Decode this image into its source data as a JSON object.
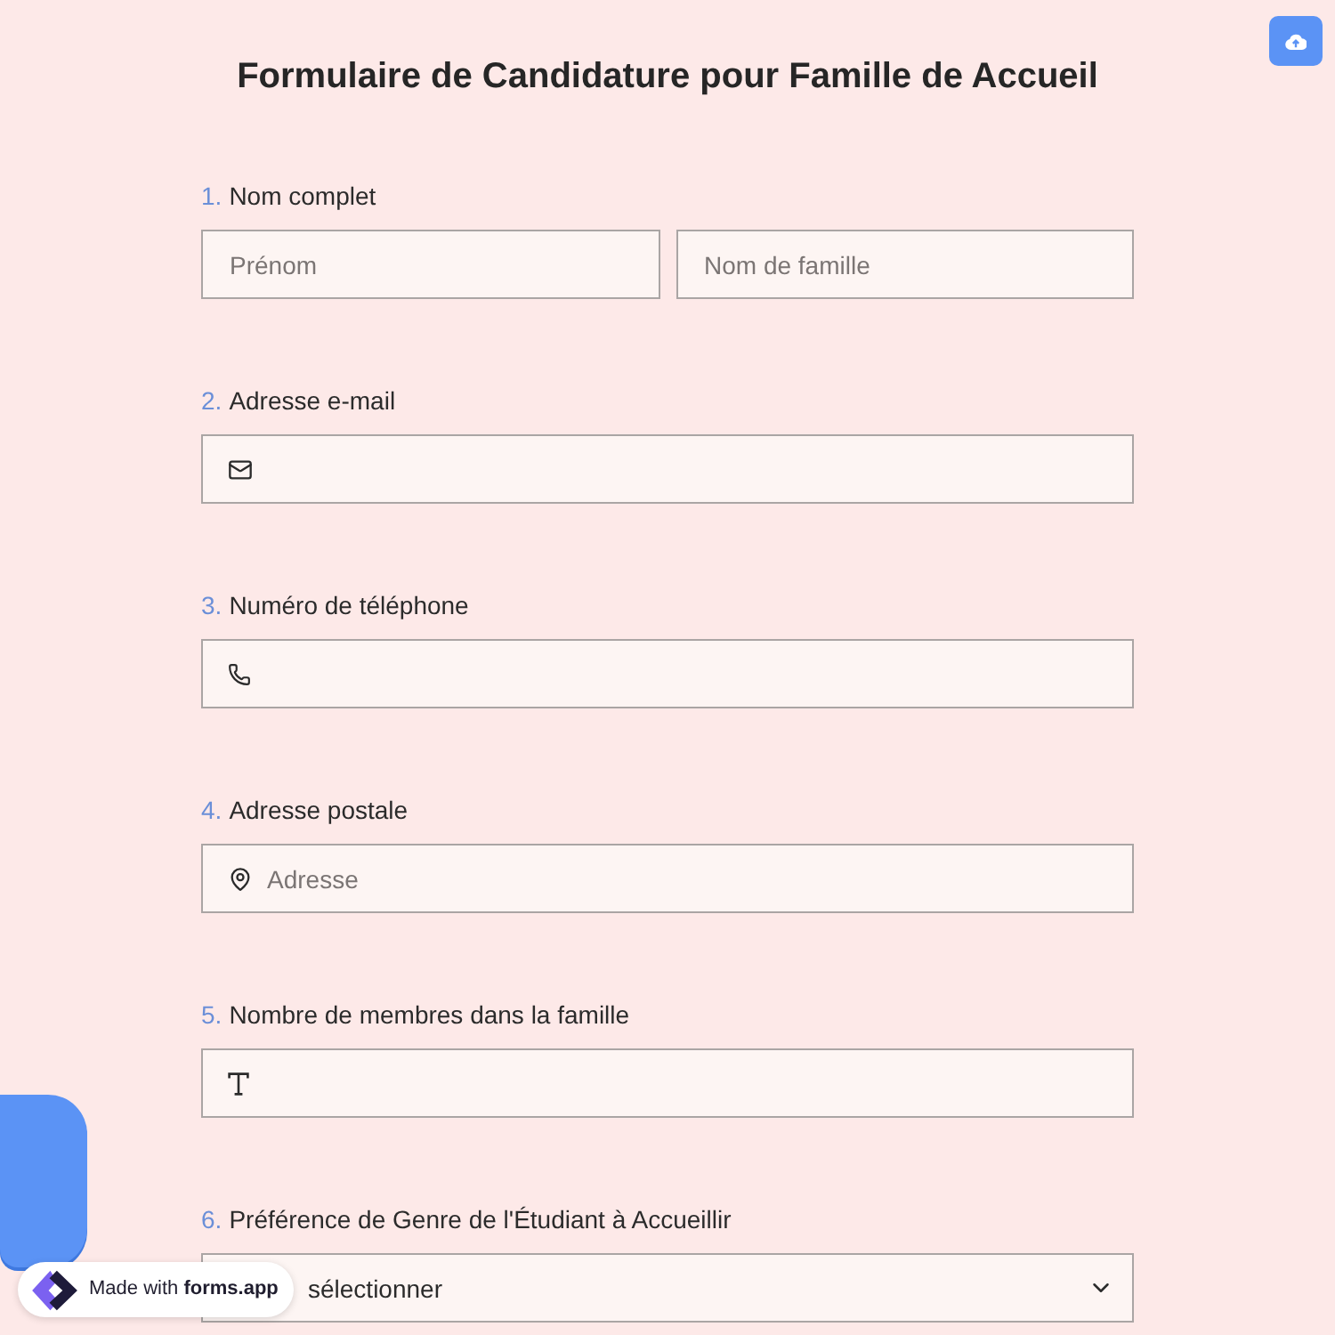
{
  "title": "Formulaire de Candidature pour Famille de Accueil",
  "questions": [
    {
      "number": "1.",
      "label": "Nom complet",
      "kind": "name",
      "fields": [
        {
          "placeholder": "Prénom"
        },
        {
          "placeholder": "Nom de famille"
        }
      ]
    },
    {
      "number": "2.",
      "label": "Adresse e-mail",
      "kind": "email"
    },
    {
      "number": "3.",
      "label": "Numéro de téléphone",
      "kind": "phone"
    },
    {
      "number": "4.",
      "label": "Adresse postale",
      "kind": "address",
      "placeholder": "Adresse"
    },
    {
      "number": "5.",
      "label": "Nombre de membres dans la famille",
      "kind": "text"
    },
    {
      "number": "6.",
      "label": "Préférence de Genre de l'Étudiant à Accueillir",
      "kind": "select",
      "placeholder": "sélectionner"
    }
  ],
  "badge": {
    "text": "Made with **forms.app**"
  }
}
